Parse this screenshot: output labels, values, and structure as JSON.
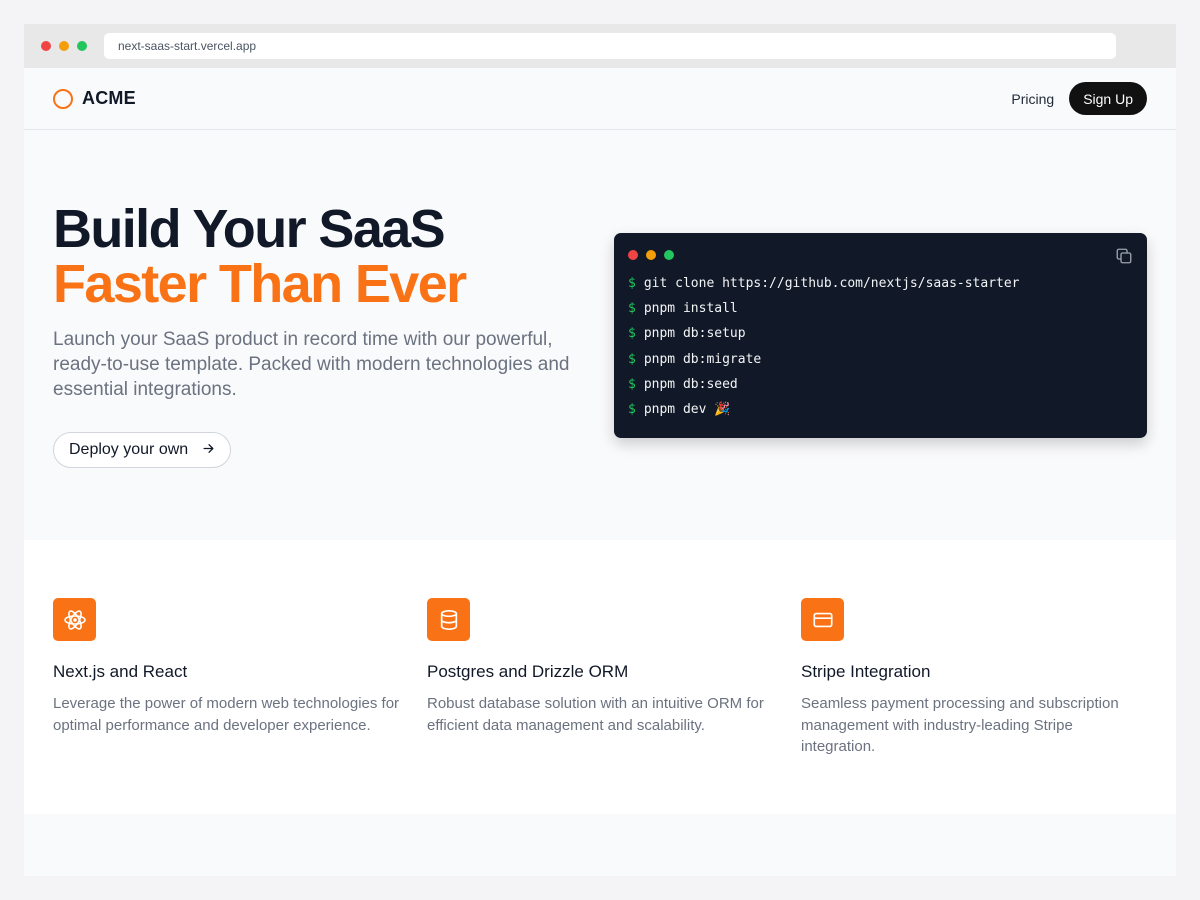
{
  "browser": {
    "url": "next-saas-start.vercel.app"
  },
  "header": {
    "brand": "ACME",
    "nav": {
      "pricing": "Pricing",
      "sign_up": "Sign Up"
    }
  },
  "hero": {
    "title_line1": "Build Your SaaS",
    "title_line2": "Faster Than Ever",
    "subtitle": "Launch your SaaS product in record time with our powerful, ready-to-use template. Packed with modern technologies and essential integrations.",
    "cta": "Deploy your own",
    "cta_icon": "arrow-right-icon"
  },
  "terminal": {
    "prompt": "$",
    "lines": [
      "git clone https://github.com/nextjs/saas-starter",
      "pnpm install",
      "pnpm db:setup",
      "pnpm db:migrate",
      "pnpm db:seed",
      "pnpm dev 🎉"
    ],
    "copy_icon": "copy-icon"
  },
  "features": [
    {
      "icon": "react-atom-icon",
      "title": "Next.js and React",
      "description": "Leverage the power of modern web technologies for optimal performance and developer experience."
    },
    {
      "icon": "database-icon",
      "title": "Postgres and Drizzle ORM",
      "description": "Robust database solution with an intuitive ORM for efficient data management and scalability."
    },
    {
      "icon": "credit-card-icon",
      "title": "Stripe Integration",
      "description": "Seamless payment processing and subscription management with industry-leading Stripe integration."
    }
  ],
  "colors": {
    "accent": "#f97316",
    "dark": "#111827",
    "terminal_bg": "#111827",
    "prompt": "#22c55e"
  }
}
